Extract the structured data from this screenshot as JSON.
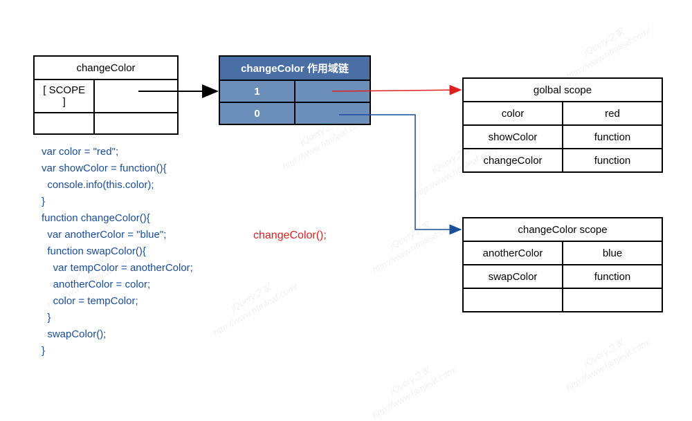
{
  "changeColorBox": {
    "title": "changeColor",
    "scopeLabel": "[ SCOPE ]"
  },
  "scopeChain": {
    "title": "changeColor 作用域链",
    "rows": [
      {
        "index": "1"
      },
      {
        "index": "0"
      }
    ]
  },
  "globalScope": {
    "title": "golbal scope",
    "rows": [
      {
        "k": "color",
        "v": "red"
      },
      {
        "k": "showColor",
        "v": "function"
      },
      {
        "k": "changeColor",
        "v": "function"
      }
    ]
  },
  "ccScope": {
    "title": "changeColor scope",
    "rows": [
      {
        "k": "anotherColor",
        "v": "blue"
      },
      {
        "k": "swapColor",
        "v": "function"
      },
      {
        "k": "",
        "v": ""
      }
    ]
  },
  "callLabel": "changeColor();",
  "code": "var color = \"red\";\nvar showColor = function(){\n  console.info(this.color);\n}\nfunction changeColor(){\n  var anotherColor = \"blue\";\n  function swapColor(){\n    var tempColor = anotherColor;\n    anotherColor = color;\n    color = tempColor;\n  }\n  swapColor();\n}",
  "watermark": {
    "text1": "jQuery之家",
    "text2": "http://www.htmleaf.com/"
  }
}
